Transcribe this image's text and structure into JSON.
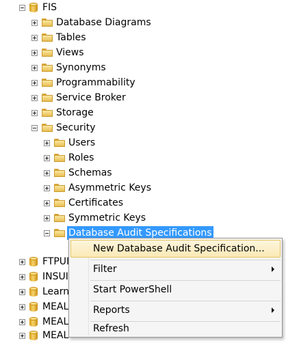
{
  "tree": {
    "root": "FIS",
    "children": [
      "Database Diagrams",
      "Tables",
      "Views",
      "Synonyms",
      "Programmability",
      "Service Broker",
      "Storage",
      "Security"
    ],
    "security_children": [
      "Users",
      "Roles",
      "Schemas",
      "Asymmetric Keys",
      "Certificates",
      "Symmetric Keys",
      "Database Audit Specifications"
    ],
    "other_databases": [
      "FTPUI",
      "INSUI",
      "Learn",
      "MEAL",
      "MEAL",
      "MEAL"
    ]
  },
  "context_menu": {
    "items": [
      {
        "label": "New Database Audit Specification...",
        "submenu": false,
        "hovered": true
      },
      {
        "label": "Filter",
        "submenu": true,
        "hovered": false
      },
      {
        "label": "Start PowerShell",
        "submenu": false,
        "hovered": false
      },
      {
        "label": "Reports",
        "submenu": true,
        "hovered": false
      },
      {
        "label": "Refresh",
        "submenu": false,
        "hovered": false
      }
    ]
  },
  "colors": {
    "selection": "#3399ff",
    "menu_hover_border": "#e5c365",
    "folder": "#e8bf52"
  },
  "icons": {
    "expanded": "minus-box-icon",
    "collapsed": "plus-box-icon",
    "folder": "folder-icon",
    "database": "database-icon",
    "submenu": "submenu-arrow-icon"
  }
}
